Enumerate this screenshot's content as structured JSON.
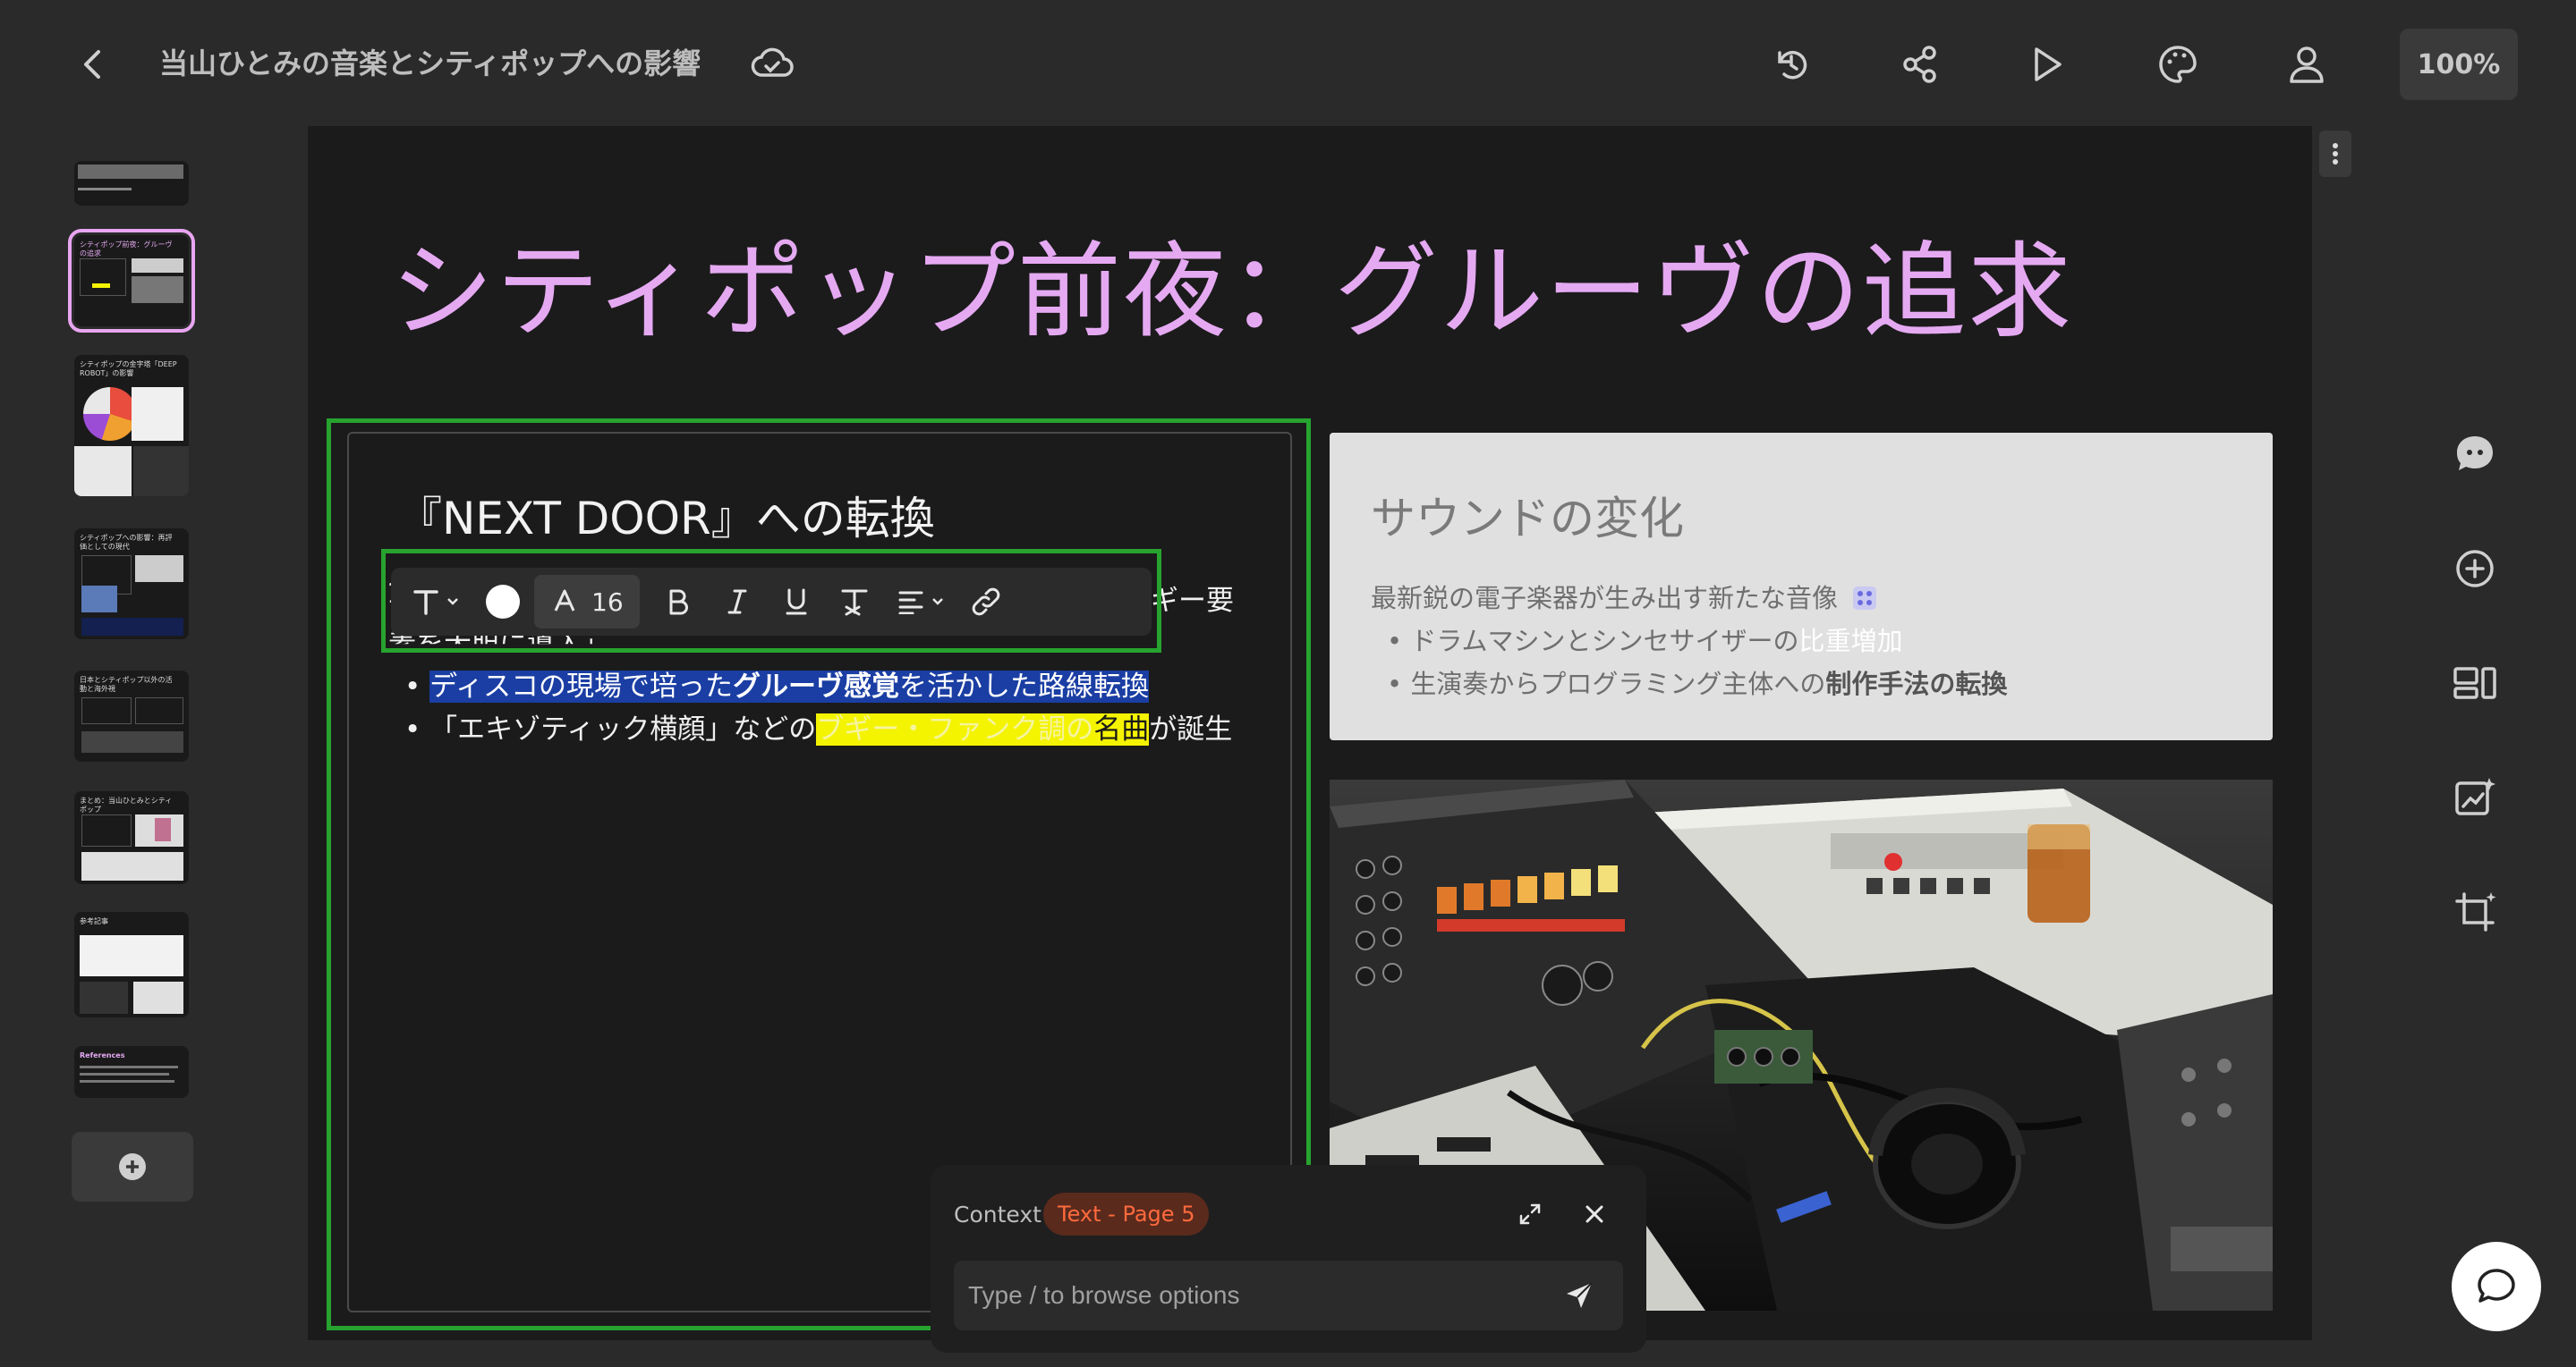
{
  "header": {
    "title": "当山ひとみの音楽とシティポップへの影響",
    "zoom": "100%"
  },
  "slide": {
    "title": "シティポップ前夜：グルーヴの追求",
    "left": {
      "heading": "『NEXT DOOR』への転換",
      "intro_start": "1",
      "intro_end": "ギー要",
      "intro_line2": "素を大胆に導入」",
      "bullet1": "ディスコの現場で培ったグルーヴ感覚を活かした路線転換",
      "bullet1_prefix": "ディスコの現場で培った",
      "bullet1_bold": "グルーヴ感覚",
      "bullet1_suffix": "を活かした路線転換",
      "bullet2_prefix": "「エキゾティック横顔」などの",
      "bullet2_hl": "ブギー・ファンク調の",
      "bullet2_hl2": "名曲",
      "bullet2_suffix": "が誕生"
    },
    "right": {
      "heading": "サウンドの変化",
      "lead": "最新鋭の電子楽器が生み出す新たな音像",
      "bullet1_prefix": "ドラムマシンとシンセサイザーの",
      "bullet1_light": "比重増加",
      "bullet2_prefix": "生演奏からプログラミング主体への",
      "bullet2_bold": "制作手法の転換"
    }
  },
  "toolbar": {
    "font_size": "16"
  },
  "thumbnails": {
    "t2": "シティポップ前夜：グルーヴの追求",
    "t3": "シティポップの金字塔「DEEP ROBOT」の影響",
    "t4": "シティポップへの影響：再評価としての現代",
    "t5": "日本とシティポップ以外の活動と海外視",
    "t6": "まとめ：当山ひとみとシティポップ",
    "t7": "参考記事",
    "t8": "References"
  },
  "context": {
    "label": "Context",
    "chip": "Text - Page 5",
    "placeholder": "Type / to browse options"
  },
  "colors": {
    "title_pink": "#e5a9f2",
    "selection_green": "#27a32f",
    "chip_orange": "#ff6a3d"
  }
}
